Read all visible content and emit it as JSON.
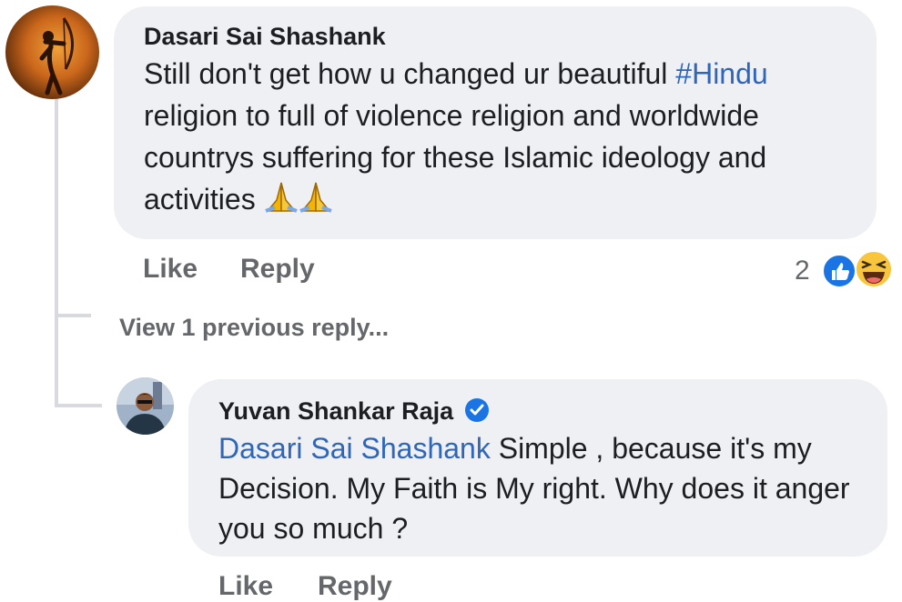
{
  "comment1": {
    "author": "Dasari Sai Shashank",
    "text_before": "Still don't get how u changed ur beautiful ",
    "hashtag": "#Hindu",
    "text_after": " religion to full of violence religion and worldwide countrys suffering for these Islamic ideology and activities",
    "emoji_icons": [
      "folded-hands-icon",
      "folded-hands-icon"
    ],
    "like_label": "Like",
    "reply_label": "Reply",
    "reaction_count": "2",
    "reaction_icons": [
      "like-reaction-icon",
      "haha-reaction-icon"
    ]
  },
  "view_previous": "View 1 previous reply...",
  "reply1": {
    "author": "Yuvan Shankar Raja",
    "verified_icon": "verified-badge-icon",
    "mention": "Dasari Sai Shashank",
    "text": " Simple , because it's my Decision. My Faith is My right. Why does it anger you so much ?",
    "like_label": "Like",
    "reply_label": "Reply"
  },
  "colors": {
    "bubble": "#eef0f3",
    "link": "#2f66b8",
    "meta": "#65676b",
    "verified": "#1b74e4"
  }
}
